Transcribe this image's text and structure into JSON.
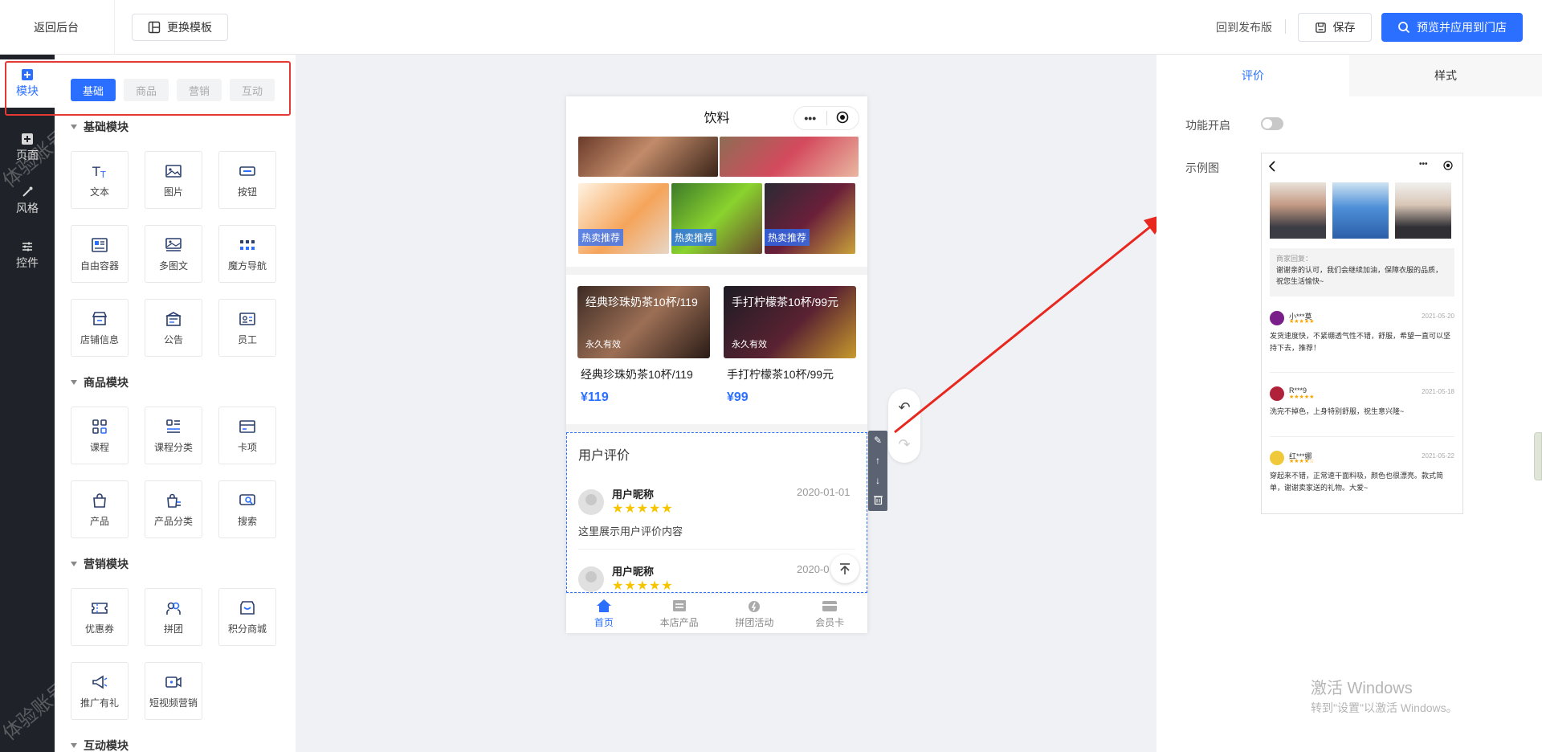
{
  "topbar": {
    "back": "返回后台",
    "template": "更换模板",
    "revert": "回到发布版",
    "save": "保存",
    "preview": "预览并应用到门店"
  },
  "sidebar": {
    "items": [
      {
        "label": "模块",
        "icon": "plus-square-icon"
      },
      {
        "label": "页面",
        "icon": "plus-square-icon"
      },
      {
        "label": "风格",
        "icon": "brush-icon"
      },
      {
        "label": "控件",
        "icon": "sliders-icon"
      }
    ],
    "watermark": "体验账号"
  },
  "panel": {
    "tabs": [
      "基础",
      "商品",
      "营销",
      "互动"
    ],
    "sections": [
      {
        "title": "基础模块",
        "items": [
          "文本",
          "图片",
          "按钮",
          "自由容器",
          "多图文",
          "魔方导航",
          "店铺信息",
          "公告",
          "员工"
        ]
      },
      {
        "title": "商品模块",
        "items": [
          "课程",
          "课程分类",
          "卡项",
          "产品",
          "产品分类",
          "搜索"
        ]
      },
      {
        "title": "营销模块",
        "items": [
          "优惠券",
          "拼团",
          "积分商城",
          "推广有礼",
          "短视频营销"
        ]
      },
      {
        "title": "互动模块",
        "items": []
      }
    ]
  },
  "phone": {
    "title": "饮料",
    "capsule_more": "•••",
    "hot_tag": "热卖推荐",
    "cards": [
      {
        "overlay": "经典珍珠奶茶10杯/119",
        "sub": "永久有效",
        "name": "经典珍珠奶茶10杯/119",
        "price": "¥119"
      },
      {
        "overlay": "手打柠檬茶10杯/99元",
        "sub": "永久有效",
        "name": "手打柠檬茶10杯/99元",
        "price": "¥99"
      }
    ],
    "review": {
      "title": "用户评价",
      "items": [
        {
          "name": "用户昵称",
          "date": "2020-01-01",
          "stars": "★★★★★",
          "content": "这里展示用户评价内容"
        },
        {
          "name": "用户昵称",
          "date": "2020-0",
          "stars": "★★★★★",
          "content": ""
        }
      ]
    },
    "nav": [
      "首页",
      "本店产品",
      "拼团活动",
      "会员卡"
    ]
  },
  "right": {
    "tabs": [
      "评价",
      "样式"
    ],
    "switch_label": "功能开启",
    "example_label": "示例图",
    "example": {
      "reply_head": "商家回复：",
      "reply_text": "谢谢亲的认可，我们会继续加油，保障衣服的品质，祝您生活愉快~",
      "reviews": [
        {
          "name": "小***莫",
          "date": "2021-05-20",
          "stars": "★★★★★",
          "text": "发货速度快，不紧绷透气性不错，舒服，希望一直可以坚持下去，推荐！"
        },
        {
          "name": "R***9",
          "date": "2021-05-18",
          "stars": "★★★★★",
          "text": "洗完不掉色，上身特别舒服，祝生意兴隆~"
        },
        {
          "name": "红***娜",
          "date": "2021-05-22",
          "stars": "★★★★☆",
          "text": "穿起来不错，正常速干面料吸，颜色也很漂亮。款式简单，谢谢卖家送的礼物。大爱~"
        }
      ]
    }
  },
  "windows": {
    "line1": "激活 Windows",
    "line2": "转到\"设置\"以激活 Windows。"
  },
  "colors": {
    "accent": "#2a6fff",
    "dark_sidebar": "#1f2329",
    "highlight": "#e53935",
    "star": "#f7c500"
  }
}
